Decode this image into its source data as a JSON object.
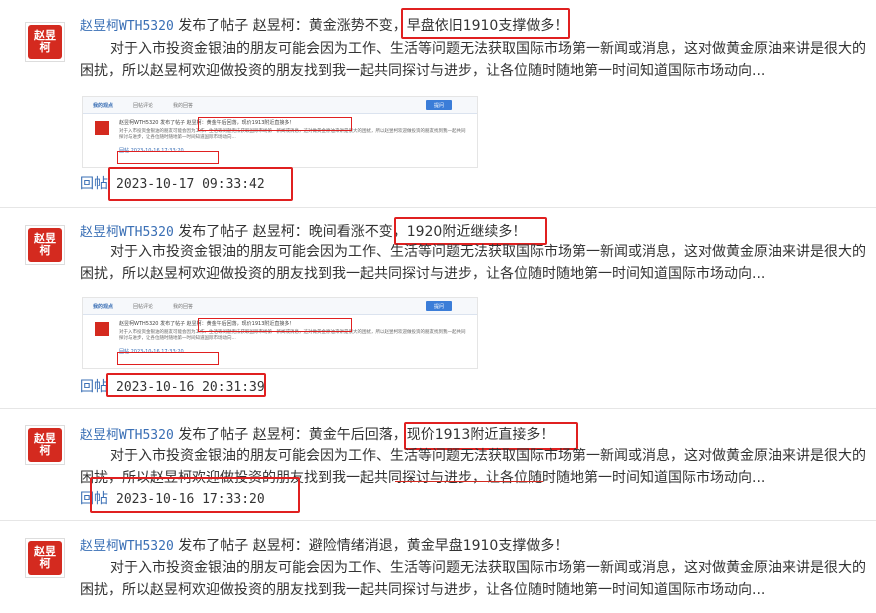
{
  "posts": [
    {
      "avatar_text": "赵昱\n柯",
      "user": "赵昱柯WTH5320",
      "action": " 发布了帖子 ",
      "title_prefix": "赵昱柯：黄金涨势不变，",
      "title_highlight": "早盘依旧1910支撑做多！",
      "body": "对于入市投资金银油的朋友可能会因为工作、生活等问题无法获取国际市场第一新闻或消息，这对做黄金原油来讲是很大的困扰，所以赵昱柯欢迎做投资的朋友找到我一起共同探讨与进步，让各位随时随地第一时间知道国际市场动向...",
      "thumb": {
        "tab1": "我的观点",
        "tab2": "回帖评论",
        "tab3": "我的回答",
        "btn": "提问",
        "mini_title": "赵昱柯WTH5320  发布了帖子  赵昱柯：黄金午后回落，现价1913附近直接多！",
        "mini_body": "对于入市投资金银油的朋友可能会因为工作、生活等问题无法获取国际市场第一新闻或消息，这对做黄金原油来讲是很大的困扰，所以赵昱柯欢迎做投资的朋友找到我一起共同探讨与进步，让各位随时随地第一时间知道国际市场动向...",
        "mini_meta": "回帖  2023-10-16 17:33:20"
      },
      "reply_label": "回帖",
      "time": "2023-10-17 09:33:42"
    },
    {
      "avatar_text": "赵昱\n柯",
      "user": "赵昱柯WTH5320",
      "action": " 发布了帖子 ",
      "title_prefix": "赵昱柯：晚间看涨不变，",
      "title_highlight": "1920附近继续多！",
      "body": "对于入市投资金银油的朋友可能会因为工作、生活等问题无法获取国际市场第一新闻或消息，这对做黄金原油来讲是很大的困扰，所以赵昱柯欢迎做投资的朋友找到我一起共同探讨与进步，让各位随时随地第一时间知道国际市场动向...",
      "thumb": {
        "tab1": "我的观点",
        "tab2": "回帖评论",
        "tab3": "我的回答",
        "btn": "提问",
        "mini_title": "赵昱柯WTH5320  发布了帖子  赵昱柯：黄金午后回落，现价1913附近直接多！",
        "mini_body": "对于入市投资金银油的朋友可能会因为工作、生活等问题无法获取国际市场第一新闻或消息，这对做黄金原油来讲是很大的困扰，所以赵昱柯欢迎做投资的朋友找到我一起共同探讨与进步，让各位随时随地第一时间知道国际市场动向...",
        "mini_meta": "回帖  2023-10-16 17:33:20"
      },
      "reply_label": "回帖",
      "time": "2023-10-16 20:31:39"
    },
    {
      "avatar_text": "赵昱\n柯",
      "user": "赵昱柯WTH5320",
      "action": " 发布了帖子 ",
      "title_prefix": "赵昱柯：黄金午后回落，",
      "title_highlight": "现价1913附近直接多！",
      "body": "对于入市投资金银油的朋友可能会因为工作、生活等问题无法获取国际市场第一新闻或消息，这对做黄金原油来讲是很大的困扰，所以赵昱柯欢迎做投资的朋友找到我一起共同探讨与进步，让各位随时随地第一时间知道国际市场动向...",
      "reply_label": "回帖",
      "time": "2023-10-16 17:33:20"
    },
    {
      "avatar_text": "赵昱\n柯",
      "user": "赵昱柯WTH5320",
      "action": " 发布了帖子 ",
      "title_prefix": "赵昱柯：避险情绪消退，黄金早盘1910支撑做多！",
      "title_highlight": "",
      "body": "对于入市投资金银油的朋友可能会因为工作、生活等问题无法获取国际市场第一新闻或消息，这对做黄金原油来讲是很大的困扰，所以赵昱柯欢迎做投资的朋友找到我一起共同探讨与进步，让各位随时随地第一时间知道国际市场动向..."
    }
  ]
}
